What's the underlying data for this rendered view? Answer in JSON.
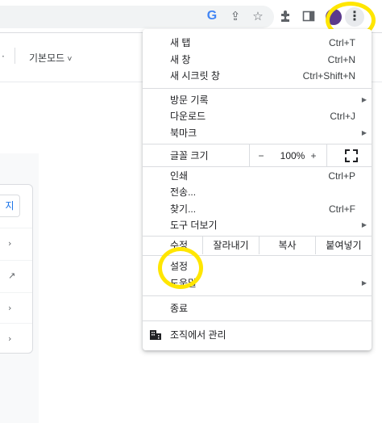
{
  "colors": {
    "accent": "#1a73e8",
    "highlight": "#ffe600",
    "avatar": "#5b3a8c"
  },
  "toolbar": {
    "icons": [
      "google-g-icon",
      "share-icon",
      "star-icon",
      "extensions-icon",
      "side-panel-icon",
      "profile-avatar",
      "more-menu-icon"
    ],
    "google_g": "G",
    "share_glyph": "⇪",
    "star_glyph": "☆",
    "puzzle_glyph": "✦",
    "kebab_glyph": "⋮"
  },
  "page": {
    "dot": "·",
    "mode_label": "기본모드",
    "chevron": "˅",
    "side_button": "지",
    "row_glyphs": [
      "›",
      "↗",
      "›",
      "›"
    ]
  },
  "menu": {
    "new_tab": {
      "label": "새 탭",
      "shortcut": "Ctrl+T"
    },
    "new_window": {
      "label": "새 창",
      "shortcut": "Ctrl+N"
    },
    "new_incognito": {
      "label": "새 시크릿 창",
      "shortcut": "Ctrl+Shift+N"
    },
    "history": {
      "label": "방문 기록"
    },
    "downloads": {
      "label": "다운로드",
      "shortcut": "Ctrl+J"
    },
    "bookmarks": {
      "label": "북마크"
    },
    "zoom": {
      "label": "글꼴 크기",
      "minus": "−",
      "value": "100%",
      "plus": "+"
    },
    "print": {
      "label": "인쇄",
      "shortcut": "Ctrl+P"
    },
    "cast": {
      "label": "전송..."
    },
    "find": {
      "label": "찾기...",
      "shortcut": "Ctrl+F"
    },
    "more_tools": {
      "label": "도구 더보기"
    },
    "edit": {
      "label": "수정",
      "cut": "잘라내기",
      "copy": "복사",
      "paste": "붙여넣기"
    },
    "settings": {
      "label": "설정"
    },
    "help": {
      "label": "도움말"
    },
    "exit": {
      "label": "종료"
    },
    "managed": {
      "label": "조직에서 관리"
    },
    "submenu_arrow": "▶"
  }
}
